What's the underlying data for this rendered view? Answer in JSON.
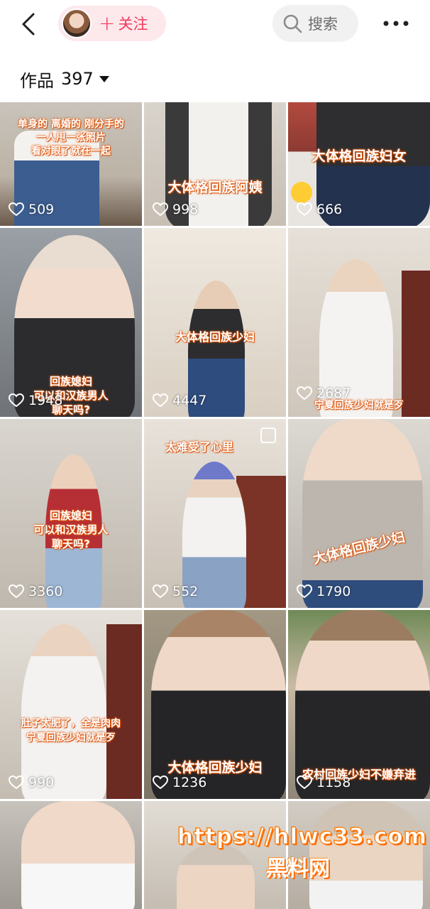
{
  "header": {
    "follow_label": "关注",
    "search_label": "搜索"
  },
  "works": {
    "label": "作品",
    "count": "397"
  },
  "tiles": [
    {
      "caption": "单身的 离婚的 刚分手的\n一人甩一张照片\n看对眼了就在一起",
      "likes": "509"
    },
    {
      "caption": "大体格回族阿姨",
      "likes": "998"
    },
    {
      "caption": "大体格回族妇女",
      "likes": "666"
    },
    {
      "caption": "回族媳妇\n可以和汉族男人\n聊天吗?",
      "likes": "1948"
    },
    {
      "caption": "大体格回族少妇",
      "likes": "4447"
    },
    {
      "caption": "宁夏回族少妇就是歹",
      "likes": "2687"
    },
    {
      "caption": "回族媳妇\n可以和汉族男人\n聊天吗?",
      "likes": "3360"
    },
    {
      "caption": "太难受了心里",
      "likes": "552"
    },
    {
      "caption": "大体格回族少妇",
      "likes": "1790"
    },
    {
      "caption": "肚子太肥了，全是肉肉\n宁夏回族少妇就是歹",
      "likes": "990"
    },
    {
      "caption": "大体格回族少妇",
      "likes": "1236"
    },
    {
      "caption": "农村回族少妇不嫌弃进",
      "likes": "1158"
    },
    {
      "caption": "",
      "likes": ""
    },
    {
      "caption": "",
      "likes": ""
    },
    {
      "caption": "",
      "likes": ""
    }
  ],
  "watermark": {
    "url": "https://hlwc33.com",
    "name": "黑料网"
  },
  "colors": {
    "accent": "#f23a5b",
    "pill_bg": "#fde8ec",
    "search_bg": "#f1f1f2"
  }
}
